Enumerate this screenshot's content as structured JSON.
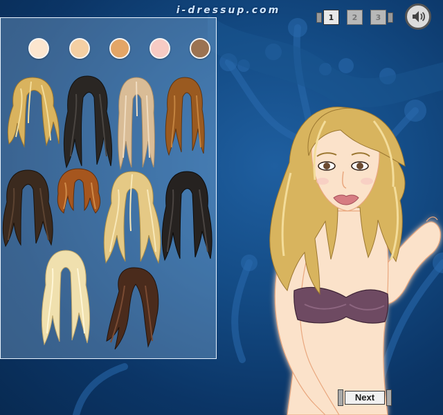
{
  "site": {
    "logo": "i-dressup.com"
  },
  "pages": {
    "items": [
      "1",
      "2",
      "3"
    ],
    "active": 1
  },
  "skin_tones": [
    "#fce6cf",
    "#f4cfa3",
    "#e3a566",
    "#f7cbc4",
    "#9b7352"
  ],
  "hair_styles": [
    {
      "name": "wavy-blonde",
      "color": "#d9b35e"
    },
    {
      "name": "long-black",
      "color": "#2a2623"
    },
    {
      "name": "straight-ash-blonde",
      "color": "#d9bc96"
    },
    {
      "name": "wavy-auburn",
      "color": "#9a5a20"
    },
    {
      "name": "dark-brown-wavy",
      "color": "#3b2a1e"
    },
    {
      "name": "auburn-bob",
      "color": "#a6561e"
    },
    {
      "name": "curly-light-blonde",
      "color": "#e5c985"
    },
    {
      "name": "wavy-black",
      "color": "#262220"
    },
    {
      "name": "platinum-blonde",
      "color": "#f0e0ae"
    },
    {
      "name": "dark-brown-straight",
      "color": "#4a2b1c"
    }
  ],
  "model": {
    "hair_color": "#d8b45e",
    "top_color": "#6e4a62",
    "skin": "#fbe2ca"
  },
  "controls": {
    "sound_icon": "speaker-icon",
    "next_label": "Next"
  }
}
